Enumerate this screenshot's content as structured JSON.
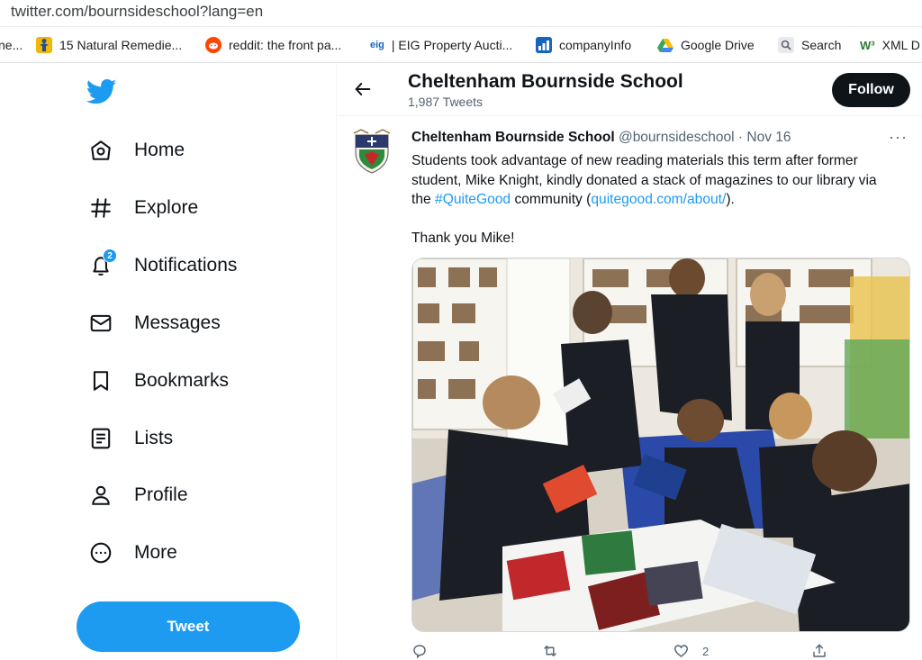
{
  "browser": {
    "url": "twitter.com/bournsideschool?lang=en",
    "bookmarks": [
      {
        "label": "ne..."
      },
      {
        "label": "15 Natural Remedie..."
      },
      {
        "label": "reddit: the front pa..."
      },
      {
        "label": "| EIG Property Aucti...",
        "fav_text": "eig"
      },
      {
        "label": "companyInfo"
      },
      {
        "label": "Google Drive"
      },
      {
        "label": "Search"
      },
      {
        "label": "XML D"
      }
    ]
  },
  "sidebar": {
    "items": [
      {
        "label": "Home"
      },
      {
        "label": "Explore"
      },
      {
        "label": "Notifications",
        "badge": "2"
      },
      {
        "label": "Messages"
      },
      {
        "label": "Bookmarks"
      },
      {
        "label": "Lists"
      },
      {
        "label": "Profile"
      },
      {
        "label": "More"
      }
    ],
    "tweet_button": "Tweet"
  },
  "header": {
    "title": "Cheltenham Bournside School",
    "tweet_count": "1,987 Tweets",
    "follow_label": "Follow"
  },
  "tweet": {
    "author_name": "Cheltenham Bournside School",
    "handle": "@bournsideschool",
    "separator": "·",
    "date": "Nov 16",
    "more": "···",
    "text_before": "Students took advantage of new reading materials this term after former student, Mike Knight, kindly donated a stack of magazines to our library via the ",
    "hashtag": "#QuiteGood",
    "text_middle": " community (",
    "link": "quitegood.com/about/",
    "text_after": ").",
    "text_thanks": "Thank you Mike!",
    "likes": "2"
  },
  "colors": {
    "accent": "#1d9bf0",
    "text": "#0f1419",
    "muted": "#536471"
  }
}
